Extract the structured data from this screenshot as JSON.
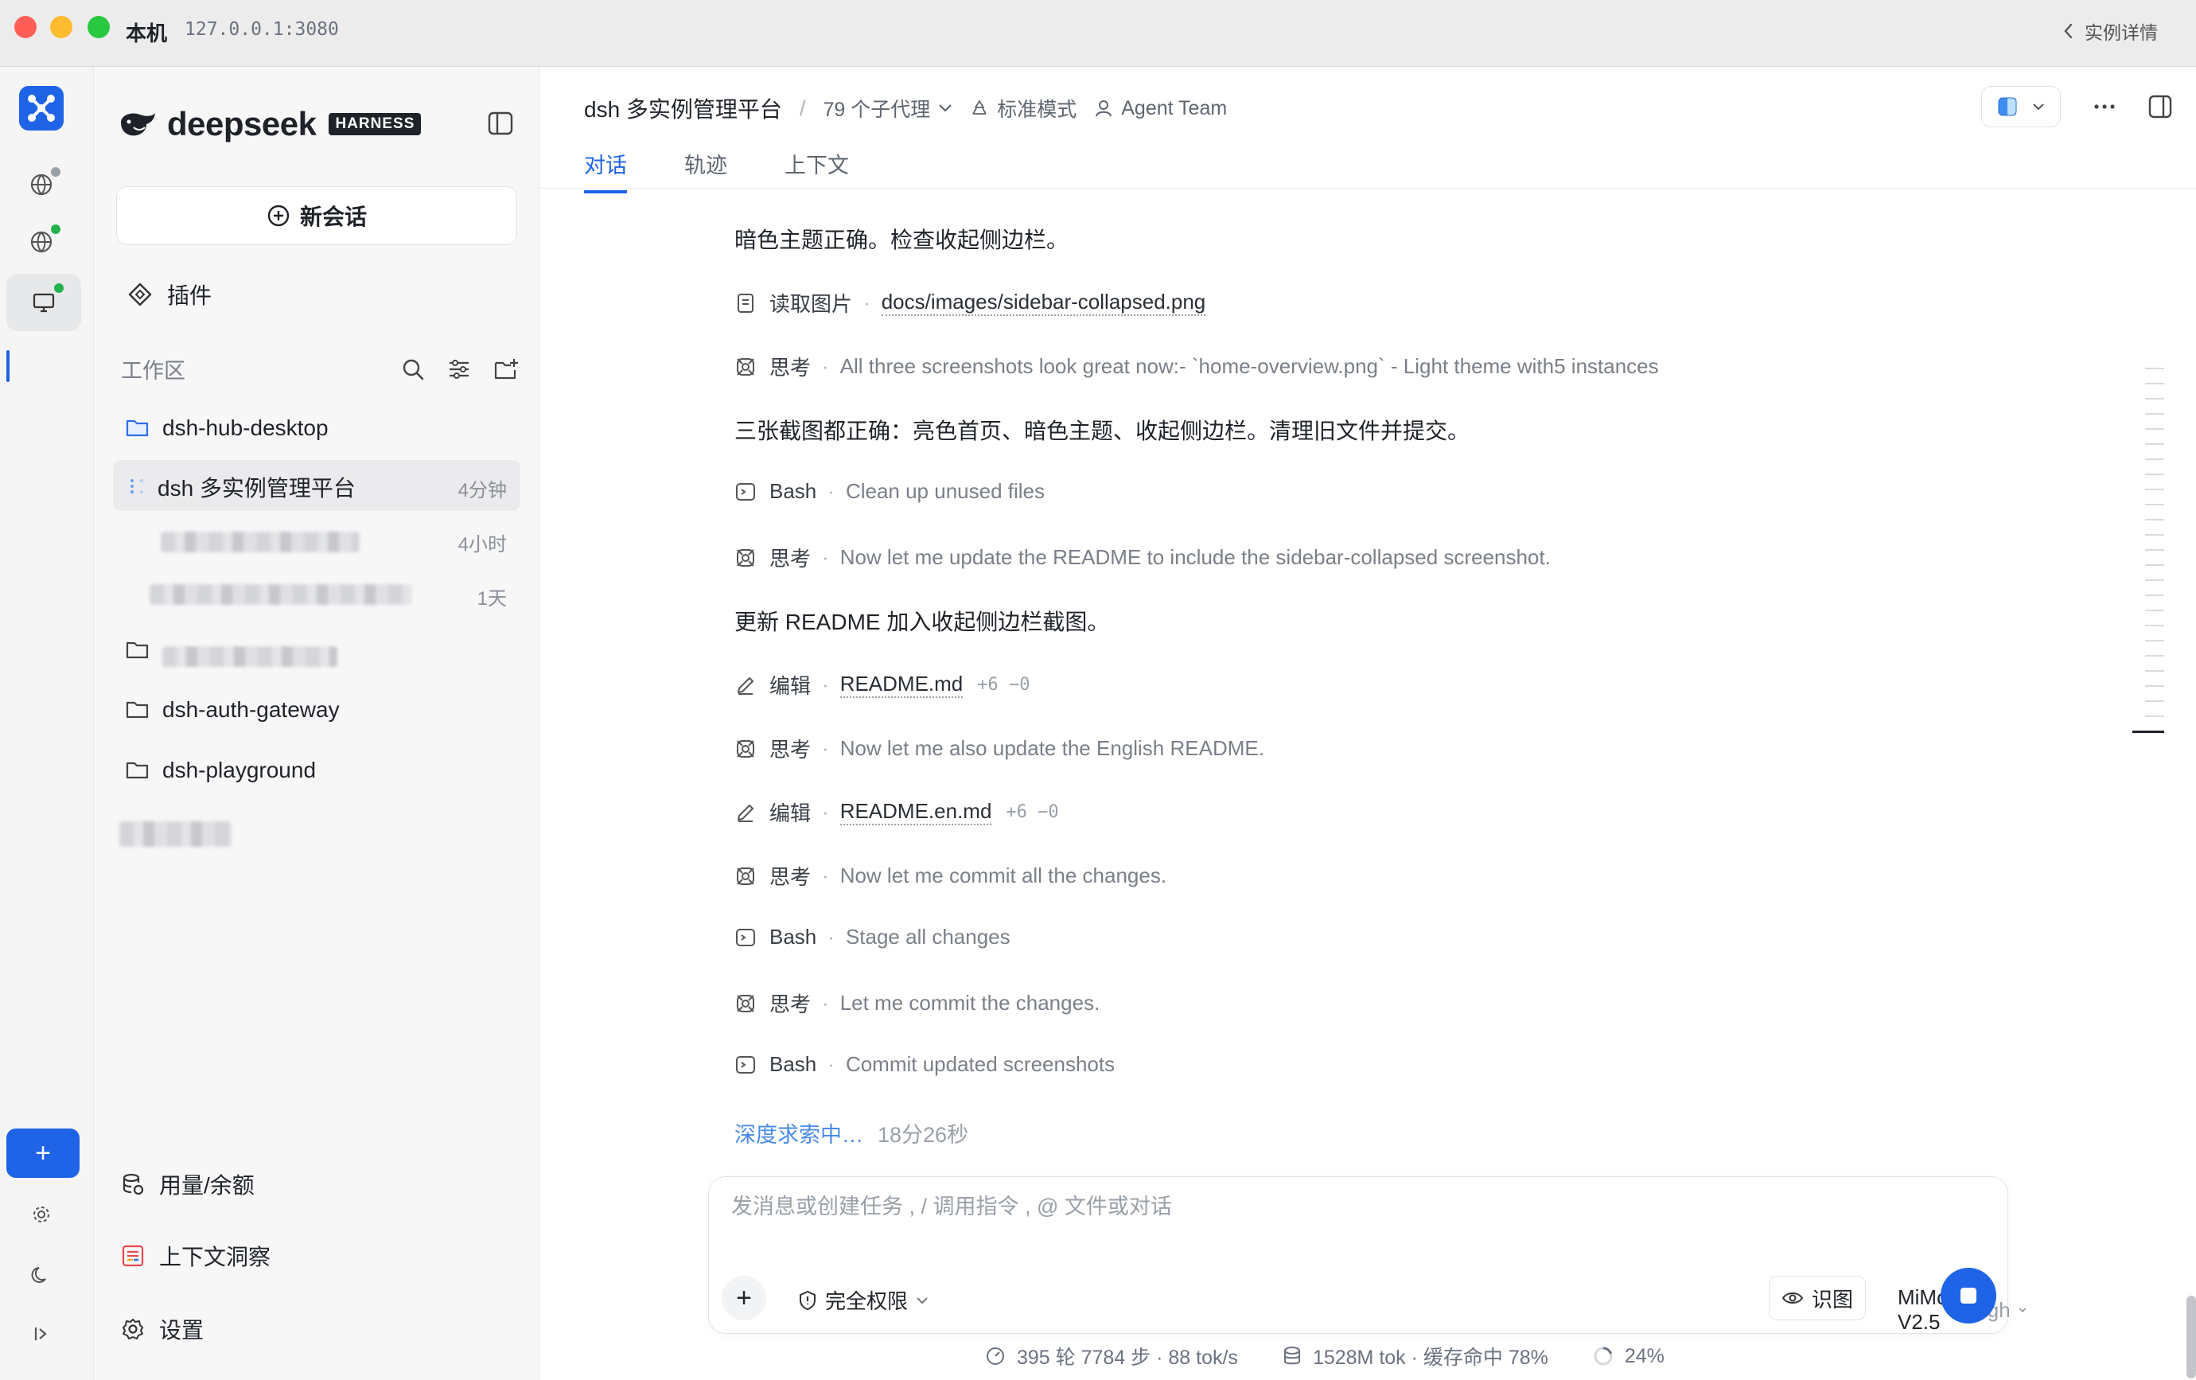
{
  "window": {
    "title": "本机",
    "address": "127.0.0.1:3080",
    "back_label": "实例详情"
  },
  "brand": {
    "name": "deepseek",
    "tag": "HARNESS"
  },
  "sidebar": {
    "new_chat": "新会话",
    "plugins": "插件",
    "workspace_title": "工作区",
    "folders": {
      "hub": "dsh-hub-desktop",
      "auth": "dsh-auth-gateway",
      "playground": "dsh-playground"
    },
    "active_session": {
      "title": "dsh 多实例管理平台",
      "time": "4分钟"
    },
    "sessions": [
      {
        "time": "4小时"
      },
      {
        "time": "1天"
      }
    ],
    "bottom": {
      "usage": "用量/余额",
      "context": "上下文洞察",
      "settings": "设置"
    }
  },
  "header": {
    "title": "dsh 多实例管理平台",
    "subagents": "79 个子代理",
    "mode": "标准模式",
    "team": "Agent Team",
    "tabs": [
      "对话",
      "轨迹",
      "上下文"
    ]
  },
  "chat": {
    "msg1": "暗色主题正确。检查收起侧边栏。",
    "msg2": "三张截图都正确：亮色首页、暗色主题、收起侧边栏。清理旧文件并提交。",
    "msg3": "更新 README 加入收起侧边栏截图。",
    "steps": [
      {
        "label": "读取图片",
        "detail": "docs/images/sidebar-collapsed.png"
      },
      {
        "label": "思考",
        "detail": "All three screenshots look great now:- `home-overview.png` - Light theme with5 instances"
      },
      {
        "label": "Bash",
        "detail": "Clean up unused files"
      },
      {
        "label": "思考",
        "detail": "Now let me update the README to include the sidebar-collapsed screenshot."
      },
      {
        "label": "编辑",
        "detail": "README.md",
        "diff": "+6 −0"
      },
      {
        "label": "思考",
        "detail": "Now let me also update the English README."
      },
      {
        "label": "编辑",
        "detail": "README.en.md",
        "diff": "+6 −0"
      },
      {
        "label": "思考",
        "detail": "Now let me commit all the changes."
      },
      {
        "label": "Bash",
        "detail": "Stage all changes"
      },
      {
        "label": "思考",
        "detail": "Let me commit the changes."
      },
      {
        "label": "Bash",
        "detail": "Commit updated screenshots"
      }
    ],
    "status": {
      "label": "深度求索中…",
      "elapsed": "18分26秒"
    }
  },
  "composer": {
    "placeholder": "发消息或创建任务 , / 调用指令 , @ 文件或对话",
    "permission": "完全权限",
    "vision": "识图",
    "model": "MiMo-V2.5",
    "level": "High"
  },
  "statusbar": {
    "turns": "395 轮 7784 步 · 88 tok/s",
    "tokens": "1528M tok · 缓存命中 78%",
    "context": "24%"
  },
  "colors": {
    "accent": "#1f63e6",
    "rail_bg": "#f5f5f6",
    "sidebar_bg": "#f7f7f8"
  }
}
